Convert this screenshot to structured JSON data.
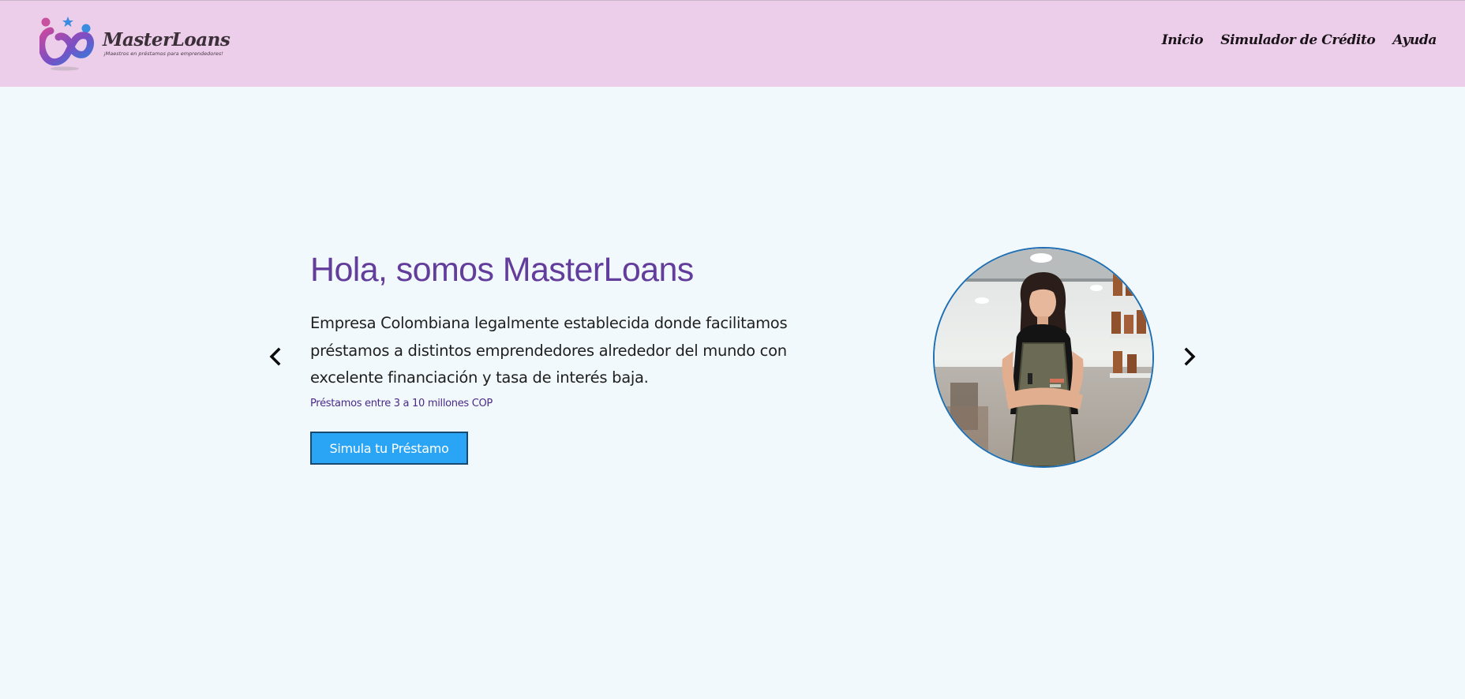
{
  "header": {
    "logo": {
      "title": "MasterLoans",
      "tagline": "¡Maestros en préstamos para emprendedores!"
    },
    "nav": [
      {
        "label": "Inicio"
      },
      {
        "label": "Simulador de Crédito"
      },
      {
        "label": "Ayuda"
      }
    ]
  },
  "hero": {
    "title": "Hola, somos MasterLoans",
    "description": "Empresa Colombiana legalmente establecida donde facilitamos préstamos a distintos emprendedores alrededor del mundo con excelente financiación y tasa de interés baja.",
    "loan_range": "Préstamos entre 3 a 10 millones COP",
    "cta_label": "Simula tu Préstamo"
  },
  "carousel": {
    "prev_icon": "chevron-left-icon",
    "next_icon": "chevron-right-icon"
  },
  "colors": {
    "header_bg": "#eccdea",
    "page_bg": "#f1f9fc",
    "title": "#633d9b",
    "accent": "#2aa5f5"
  }
}
